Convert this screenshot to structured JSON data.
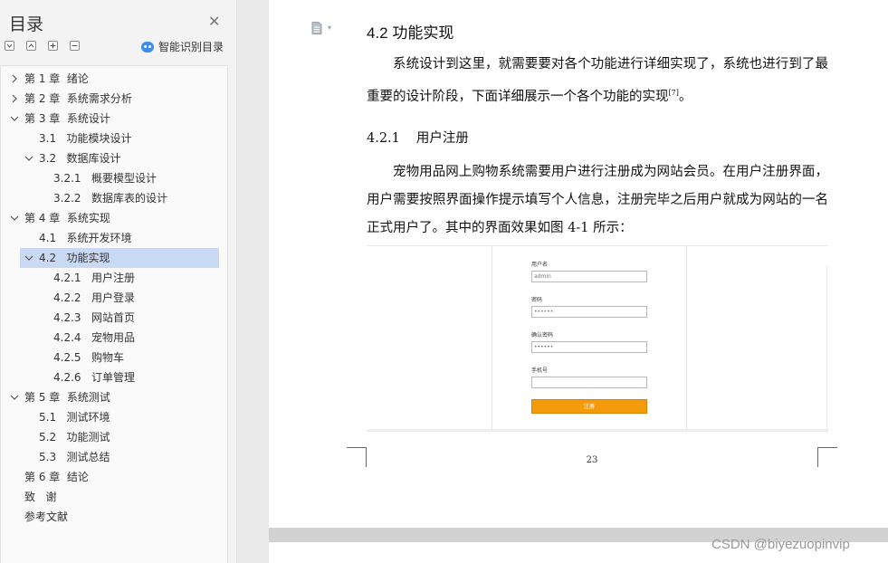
{
  "sidebar": {
    "title": "目录",
    "smart_toc_label": "智能识别目录",
    "items": [
      {
        "label": "第 1 章  绪论",
        "level": 1,
        "chevron": "right"
      },
      {
        "label": "第 2 章  系统需求分析",
        "level": 1,
        "chevron": "right"
      },
      {
        "label": "第 3 章  系统设计",
        "level": 1,
        "chevron": "down"
      },
      {
        "label": "3.1   功能模块设计",
        "level": 2,
        "chevron": "none"
      },
      {
        "label": "3.2   数据库设计",
        "level": 2,
        "chevron": "down"
      },
      {
        "label": "3.2.1   概要模型设计",
        "level": 3,
        "chevron": "none"
      },
      {
        "label": "3.2.2   数据库表的设计",
        "level": 3,
        "chevron": "none"
      },
      {
        "label": "第 4 章  系统实现",
        "level": 1,
        "chevron": "down"
      },
      {
        "label": "4.1   系统开发环境",
        "level": 2,
        "chevron": "none"
      },
      {
        "label": "4.2   功能实现",
        "level": 2,
        "chevron": "down",
        "active": true
      },
      {
        "label": "4.2.1   用户注册",
        "level": 3,
        "chevron": "none"
      },
      {
        "label": "4.2.2   用户登录",
        "level": 3,
        "chevron": "none"
      },
      {
        "label": "4.2.3   网站首页",
        "level": 3,
        "chevron": "none"
      },
      {
        "label": "4.2.4   宠物用品",
        "level": 3,
        "chevron": "none"
      },
      {
        "label": "4.2.5   购物车",
        "level": 3,
        "chevron": "none"
      },
      {
        "label": "4.2.6   订单管理",
        "level": 3,
        "chevron": "none"
      },
      {
        "label": "第 5 章  系统测试",
        "level": 1,
        "chevron": "down"
      },
      {
        "label": "5.1   测试环境",
        "level": 2,
        "chevron": "none"
      },
      {
        "label": "5.2   功能测试",
        "level": 2,
        "chevron": "none"
      },
      {
        "label": "5.3   测试总结",
        "level": 2,
        "chevron": "none"
      },
      {
        "label": "第 6 章  结论",
        "level": 1,
        "chevron": "none"
      },
      {
        "label": "致   谢",
        "level": 1,
        "chevron": "none"
      },
      {
        "label": "参考文献",
        "level": 1,
        "chevron": "none"
      }
    ]
  },
  "document": {
    "section_title": "4.2   功能实现",
    "para1_text": "系统设计到这里，就需要要对各个功能进行详细实现了，系统也进行到了最重要的设计阶段，下面详细展示一个各个功能的实现",
    "para1_ref": "[7]",
    "para1_end": "。",
    "subsection_number": "4.2.1",
    "subsection_title": "用户注册",
    "para2": "宠物用品网上购物系统需要用户进行注册成为网站会员。在用户注册界面，用户需要按照界面操作提示填写个人信息，注册完毕之后用户就成为网站的一名正式用户了。其中的界面效果如图 4-1 所示：",
    "page_number": "23"
  },
  "figure": {
    "username_label": "用户名",
    "username_value": "admin",
    "password_label": "密码",
    "password_value": "••••••",
    "confirm_label": "确认密码",
    "confirm_value": "••••••",
    "phone_label": "手机号",
    "phone_value": "",
    "submit_label": "注册"
  },
  "watermark": "CSDN @biyezuopinvip"
}
